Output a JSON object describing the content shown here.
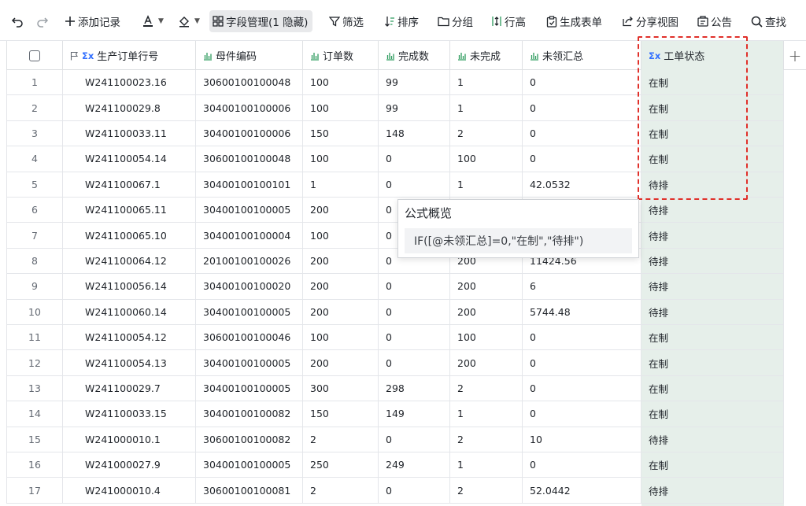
{
  "toolbar": {
    "add_record": "添加记录",
    "field_manage": "字段管理(1 隐藏)",
    "filter": "筛选",
    "sort": "排序",
    "group": "分组",
    "row_height": "行高",
    "gen_form": "生成表单",
    "share_view": "分享视图",
    "notice": "公告",
    "search": "查找"
  },
  "columns": {
    "order_line": "生产订单行号",
    "parent_code": "母件编码",
    "order_qty": "订单数",
    "done_qty": "完成数",
    "undone": "未完成",
    "unclaimed": "未领汇总",
    "status": "工单状态"
  },
  "rows": [
    {
      "idx": "1",
      "order": "W241100023.16",
      "parent": "30600100100048",
      "qty": "100",
      "done": "99",
      "undone": "1",
      "unclaimed": "0",
      "status": "在制"
    },
    {
      "idx": "2",
      "order": "W241100029.8",
      "parent": "30400100100006",
      "qty": "100",
      "done": "99",
      "undone": "1",
      "unclaimed": "0",
      "status": "在制"
    },
    {
      "idx": "3",
      "order": "W241100033.11",
      "parent": "30400100100006",
      "qty": "150",
      "done": "148",
      "undone": "2",
      "unclaimed": "0",
      "status": "在制"
    },
    {
      "idx": "4",
      "order": "W241100054.14",
      "parent": "30600100100048",
      "qty": "100",
      "done": "0",
      "undone": "100",
      "unclaimed": "0",
      "status": "在制"
    },
    {
      "idx": "5",
      "order": "W241100067.1",
      "parent": "30400100100101",
      "qty": "1",
      "done": "0",
      "undone": "1",
      "unclaimed": "42.0532",
      "status": "待排"
    },
    {
      "idx": "6",
      "order": "W241100065.11",
      "parent": "30400100100005",
      "qty": "200",
      "done": "0",
      "undone": "",
      "unclaimed": "",
      "status": "待排"
    },
    {
      "idx": "7",
      "order": "W241100065.10",
      "parent": "30400100100004",
      "qty": "100",
      "done": "0",
      "undone": "",
      "unclaimed": "",
      "status": "待排"
    },
    {
      "idx": "8",
      "order": "W241100064.12",
      "parent": "20100100100026",
      "qty": "200",
      "done": "0",
      "undone": "200",
      "unclaimed": "11424.56",
      "status": "待排"
    },
    {
      "idx": "9",
      "order": "W241100056.14",
      "parent": "30400100100020",
      "qty": "200",
      "done": "0",
      "undone": "200",
      "unclaimed": "6",
      "status": "待排"
    },
    {
      "idx": "10",
      "order": "W241100060.14",
      "parent": "30400100100005",
      "qty": "200",
      "done": "0",
      "undone": "200",
      "unclaimed": "5744.48",
      "status": "待排"
    },
    {
      "idx": "11",
      "order": "W241100054.12",
      "parent": "30600100100046",
      "qty": "100",
      "done": "0",
      "undone": "100",
      "unclaimed": "0",
      "status": "在制"
    },
    {
      "idx": "12",
      "order": "W241100054.13",
      "parent": "30400100100005",
      "qty": "200",
      "done": "0",
      "undone": "200",
      "unclaimed": "0",
      "status": "在制"
    },
    {
      "idx": "13",
      "order": "W241100029.7",
      "parent": "30400100100005",
      "qty": "300",
      "done": "298",
      "undone": "2",
      "unclaimed": "0",
      "status": "在制"
    },
    {
      "idx": "14",
      "order": "W241100033.15",
      "parent": "30400100100082",
      "qty": "150",
      "done": "149",
      "undone": "1",
      "unclaimed": "0",
      "status": "在制"
    },
    {
      "idx": "15",
      "order": "W241000010.1",
      "parent": "30600100100082",
      "qty": "2",
      "done": "0",
      "undone": "2",
      "unclaimed": "10",
      "status": "待排"
    },
    {
      "idx": "16",
      "order": "W241000027.9",
      "parent": "30400100100005",
      "qty": "250",
      "done": "249",
      "undone": "1",
      "unclaimed": "0",
      "status": "在制"
    },
    {
      "idx": "17",
      "order": "W241000010.4",
      "parent": "30600100100081",
      "qty": "2",
      "done": "0",
      "undone": "2",
      "unclaimed": "52.0442",
      "status": "待排"
    }
  ],
  "tooltip": {
    "title": "公式概览",
    "formula": "IF([@未领汇总]=0,\"在制\",\"待排\")"
  },
  "colors": {
    "status_column_bg": "#e6efea",
    "highlight": "#e0302a",
    "formula_icon": "#3370ff",
    "number_icon": "#2e9c5f"
  }
}
